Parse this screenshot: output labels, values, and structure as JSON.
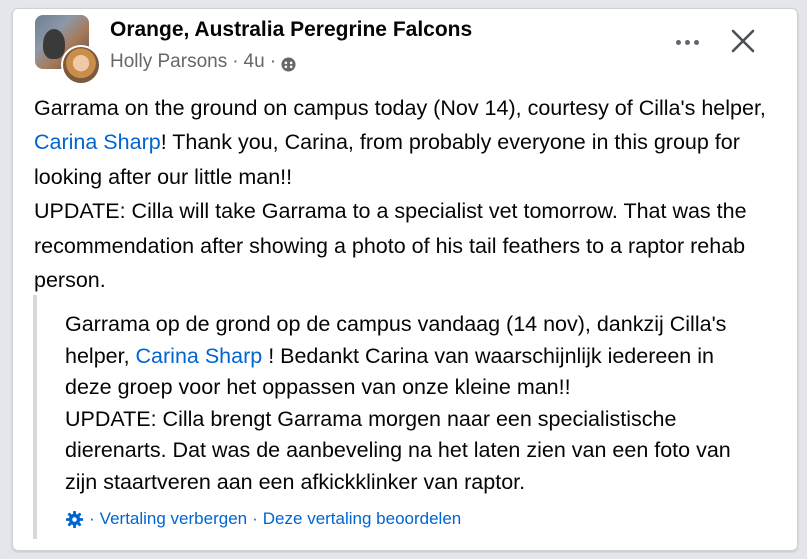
{
  "post": {
    "group_name": "Orange, Australia Peregrine Falcons",
    "author": "Holly Parsons",
    "separator": "·",
    "time": "4u",
    "privacy_icon": "globe-icon",
    "more_icon": "more-options-icon",
    "close_icon": "close-icon",
    "body": {
      "p1_a": "Garrama on the ground on campus today (Nov 14), courtesy of Cilla's helper, ",
      "p1_link": "Carina Sharp",
      "p1_b": "! Thank you, Carina, from probably everyone in this group for looking after our little man!!",
      "p2": "UPDATE: Cilla will take Garrama to a specialist vet tomorrow. That was the recommendation after showing a photo of his tail feathers to a raptor rehab person."
    }
  },
  "translation": {
    "p1_a": "Garrama op de grond op de campus vandaag (14 nov), dankzij Cilla's helper, ",
    "p1_link": "Carina Sharp",
    "p1_b": " ! Bedankt Carina van waarschijnlijk iedereen in deze groep voor het oppassen van onze kleine man!!",
    "p2": "UPDATE: Cilla brengt Garrama morgen naar een specialistische dierenarts. Dat was de aanbeveling na het laten zien van een foto van zijn staartveren aan een afkickklinker van raptor.",
    "footer": {
      "icon": "gear-icon",
      "separator": "·",
      "hide_label": "Vertaling verbergen",
      "rate_label": "Deze vertaling beoordelen"
    }
  },
  "colors": {
    "link": "#0064d1",
    "secondary_text": "#65676b",
    "primary_text": "#050505",
    "quote_bar": "#d7d9dd"
  }
}
